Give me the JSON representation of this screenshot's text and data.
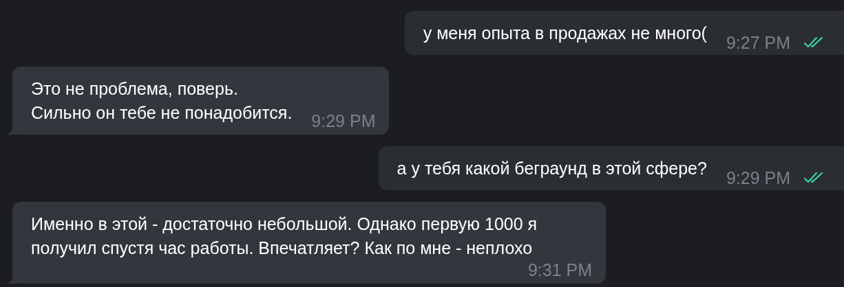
{
  "messages": [
    {
      "kind": "out",
      "text": "у меня опыта в продажах не много(",
      "time": "9:27 PM",
      "read": true
    },
    {
      "kind": "in",
      "text": "Это не проблема, поверь.\nСильно он тебе не понадобится.",
      "time": "9:29 PM",
      "read": false
    },
    {
      "kind": "out",
      "text": "а у тебя какой беграунд в этой сфере?",
      "time": "9:29 PM",
      "read": true
    },
    {
      "kind": "in",
      "text": "Именно в этой - достаточно небольшой. Однако первую 1000 я получил спустя час работы. Впечатляет? Как по мне - неплохо",
      "time": "9:31 PM",
      "read": false
    }
  ]
}
